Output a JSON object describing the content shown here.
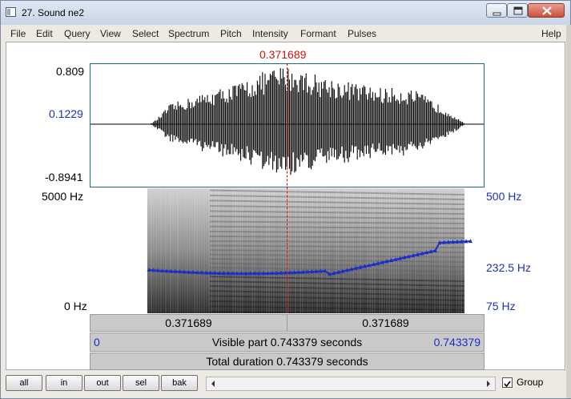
{
  "window": {
    "title": "27. Sound ne2"
  },
  "menu": {
    "items": [
      "File",
      "Edit",
      "Query",
      "View",
      "Select",
      "Spectrum",
      "Pitch",
      "Intensity",
      "Formant",
      "Pulses"
    ],
    "help": "Help"
  },
  "editor": {
    "cursor_time": "0.371689",
    "wave_max": "0.809",
    "wave_cursor_value": "0.1229",
    "wave_min": "-0.8941",
    "spec_top": "5000 Hz",
    "spec_bottom": "0 Hz",
    "pitch_top": "500 Hz",
    "pitch_mid": "232.5 Hz",
    "pitch_bottom": "75 Hz",
    "left_segment": "0.371689",
    "right_segment": "0.371689",
    "visible_start": "0",
    "visible_part": "Visible part 0.743379 seconds",
    "visible_end": "0.743379",
    "total_duration": "Total duration 0.743379 seconds"
  },
  "bottom": {
    "buttons": [
      "all",
      "in",
      "out",
      "sel",
      "bak"
    ],
    "group_label": "Group",
    "group_checked": true
  },
  "colors": {
    "pitch_line": "#1a2fc8",
    "cursor": "#d01010",
    "wave_frame": "#1d6d76"
  }
}
